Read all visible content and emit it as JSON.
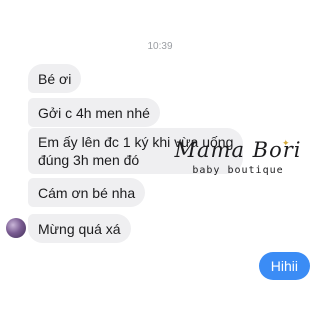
{
  "timestamp": "10:39",
  "received_messages": [
    {
      "lines": [
        "Bé ơi"
      ]
    },
    {
      "lines": [
        "Gởi c 4h men nhé"
      ]
    },
    {
      "lines": [
        "Em ấy lên đc 1 ký khi vừa uống",
        "đúng 3h men đó"
      ]
    },
    {
      "lines": [
        "Cám ơn bé nha"
      ]
    },
    {
      "lines": [
        "Mừng quá xá"
      ]
    }
  ],
  "sent_message": "Hihii",
  "watermark": {
    "name": "Mama Bori",
    "subtitle": "baby boutique"
  },
  "colors": {
    "received_bubble": "#efeff1",
    "sent_bubble": "#3b8cf5",
    "timestamp": "#9b9ea3"
  }
}
